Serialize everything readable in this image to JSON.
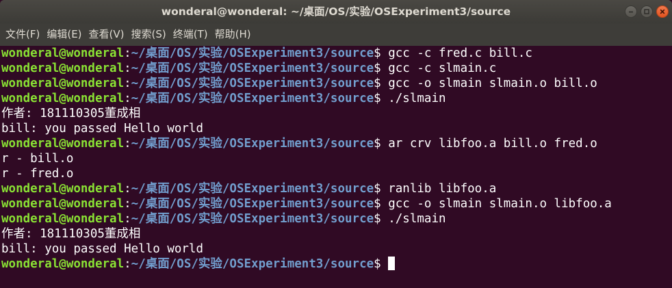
{
  "window": {
    "title": "wonderal@wonderal: ~/桌面/OS/实验/OSExperiment3/source",
    "controls": [
      "minimize-icon",
      "maximize-icon",
      "close-icon"
    ]
  },
  "menubar": {
    "items": [
      "文件(F)",
      "编辑(E)",
      "查看(V)",
      "搜索(S)",
      "终端(T)",
      "帮助(H)"
    ]
  },
  "prompt": {
    "user": "wonderal@wonderal",
    "separator": ":",
    "path": "~/桌面/OS/实验/OSExperiment3/source",
    "symbol": "$"
  },
  "terminal": {
    "lines": [
      {
        "type": "cmd",
        "text": " gcc -c fred.c bill.c"
      },
      {
        "type": "cmd",
        "text": " gcc -c slmain.c"
      },
      {
        "type": "cmd",
        "text": " gcc -o slmain slmain.o bill.o"
      },
      {
        "type": "cmd",
        "text": " ./slmain"
      },
      {
        "type": "out",
        "text": "作者: 181110305董成相"
      },
      {
        "type": "out",
        "text": "bill: you passed Hello world"
      },
      {
        "type": "cmd",
        "text": " ar crv libfoo.a bill.o fred.o"
      },
      {
        "type": "out",
        "text": "r - bill.o"
      },
      {
        "type": "out",
        "text": "r - fred.o"
      },
      {
        "type": "cmd",
        "text": " ranlib libfoo.a"
      },
      {
        "type": "cmd",
        "text": " gcc -o slmain slmain.o libfoo.a"
      },
      {
        "type": "cmd",
        "text": " ./slmain"
      },
      {
        "type": "out",
        "text": "作者: 181110305董成相"
      },
      {
        "type": "out",
        "text": "bill: you passed Hello world"
      },
      {
        "type": "cursor",
        "text": ""
      }
    ]
  },
  "colors": {
    "background": "#300a24",
    "prompt_user": "#8ae234",
    "prompt_path": "#729fcf",
    "text": "#ffffff",
    "titlebar": "#3c3b37",
    "close_button": "#e95420"
  }
}
